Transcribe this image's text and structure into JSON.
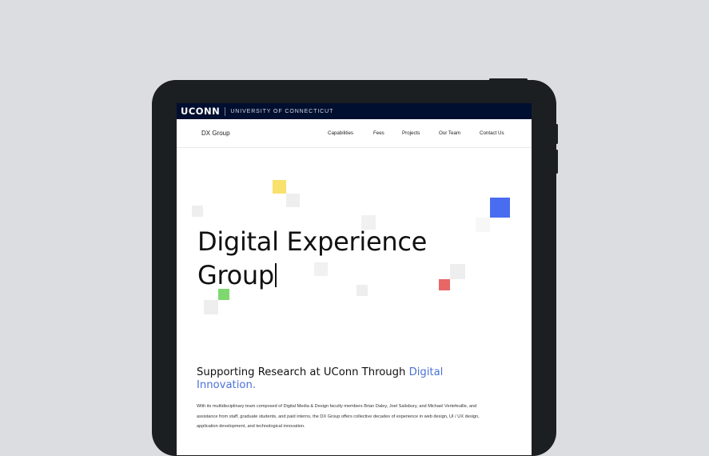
{
  "topbar": {
    "logo": "UCONN",
    "university": "UNIVERSITY OF CONNECTICUT"
  },
  "site": {
    "title": "DX Group"
  },
  "nav": {
    "items": [
      "Capabilities",
      "Fees",
      "Projects",
      "Our Team",
      "Contact Us"
    ]
  },
  "hero": {
    "line1": "Digital Experience",
    "line2": "Group"
  },
  "section": {
    "heading_main": "Supporting Research at UConn Through ",
    "heading_accent": "Digital Innovation.",
    "body": "With its multidisciplinary team composed of Digital Media & Design faculty members Brian Daley, Joel Salisbury, and Michael Vertefeuille, and assistance from staff, graduate students, and paid interns, the DX Group offers collective decades of experience in web design, UI / UX design, application development, and technological innovation."
  },
  "colors": {
    "accent": "#4a72d8",
    "topbar": "#000e2f",
    "square_yellow": "#f8e16c",
    "square_blue": "#4a6cf0",
    "square_red": "#e86666",
    "square_green": "#7fd86f",
    "square_gray": "#eeeeee"
  }
}
